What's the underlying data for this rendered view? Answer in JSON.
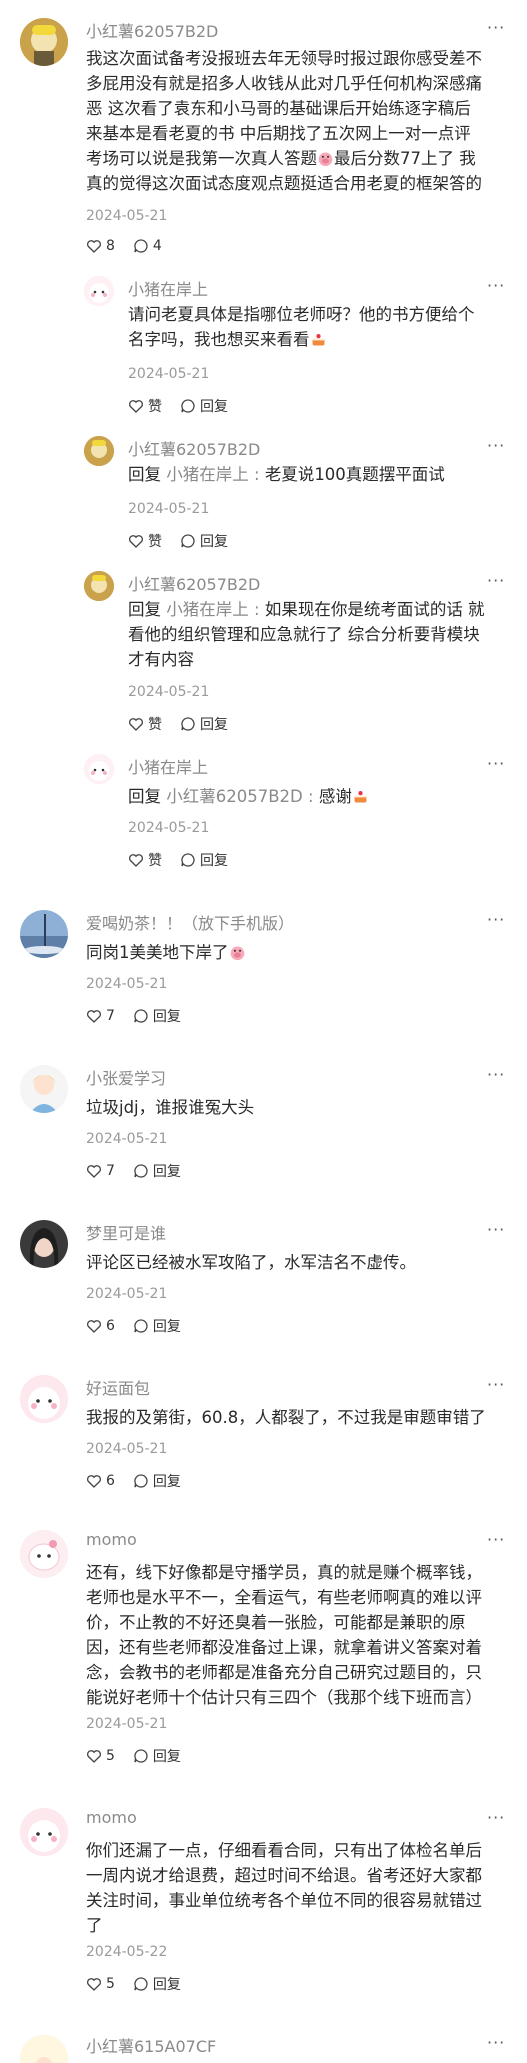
{
  "comments": [
    {
      "name": "小红薯62057B2D",
      "text_lines": [
        "我这次面试备考没报班去年无领导时报过跟你感受差不",
        "多屁用没有就是招多人收钱从此对几乎任何机构深感痛",
        "恶 这次看了袁东和小马哥的基础课后开始练逐字稿后",
        "来基本是看老夏的书 中后期找了五次网上一对一点评",
        "考场可以说是我第一次真人答题",
        "最后分数77上了 我",
        "真的觉得这次面试态度观点题挺适合用老夏的框架答的"
      ],
      "date": "2024-05-21",
      "likes": "8",
      "comments_count": "4",
      "replies": [
        {
          "name": "小猪在岸上",
          "text_lines": [
            "请问老夏具体是指哪位老师呀？他的书方便给个",
            "名字吗，我也想买来看看"
          ],
          "date": "2024-05-21",
          "like_label": "赞",
          "reply_label": "回复"
        },
        {
          "name": "小红薯62057B2D",
          "reply_prefix": "回复",
          "reply_to": "小猪在岸上",
          "colon": " : ",
          "text": "老夏说100真题摆平面试",
          "date": "2024-05-21",
          "like_label": "赞",
          "reply_label": "回复"
        },
        {
          "name": "小红薯62057B2D",
          "reply_prefix": "回复",
          "reply_to": "小猪在岸上",
          "colon": " : ",
          "text_lines": [
            "如果现在你是统考面试的话 就",
            "看他的组织管理和应急就行了 综合分析要背模块",
            "才有内容"
          ],
          "date": "2024-05-21",
          "like_label": "赞",
          "reply_label": "回复"
        },
        {
          "name": "小猪在岸上",
          "reply_prefix": "回复",
          "reply_to": "小红薯62057B2D",
          "colon": " : ",
          "text": "感谢",
          "date": "2024-05-21",
          "like_label": "赞",
          "reply_label": "回复"
        }
      ]
    },
    {
      "name": "爱喝奶茶！！（放下手机版）",
      "text": "同岗1美美地下岸了",
      "date": "2024-05-21",
      "likes": "7",
      "reply_label": "回复"
    },
    {
      "name": "小张爱学习",
      "text": "垃圾jdj，谁报谁冤大头",
      "date": "2024-05-21",
      "likes": "7",
      "reply_label": "回复"
    },
    {
      "name": "梦里可是谁",
      "text": "评论区已经被水军攻陷了，水军洁名不虚传。",
      "date": "2024-05-21",
      "likes": "6",
      "reply_label": "回复"
    },
    {
      "name": "好运面包",
      "text": "我报的及第街，60.8，人都裂了，不过我是审题审错了",
      "date": "2024-05-21",
      "likes": "6",
      "reply_label": "回复"
    },
    {
      "name": "momo",
      "text_lines": [
        "还有，线下好像都是守播学员，真的就是赚个概率钱，",
        "老师也是水平不一，全看运气，有些老师啊真的难以评",
        "价，不止教的不好还臭着一张脸，可能都是兼职的原",
        "因，还有些老师都没准备过上课，就拿着讲义答案对着",
        "念，会教书的老师都是准备充分自己研究过题目的，只",
        "能说好老师十个估计只有三四个（我那个线下班而言）"
      ],
      "date": "2024-05-21",
      "likes": "5",
      "reply_label": "回复"
    },
    {
      "name": "momo",
      "text_lines": [
        "你们还漏了一点，仔细看看合同，只有出了体检名单后",
        "一周内说才给退费，超过时间不给退。省考还好大家都",
        "关注时间，事业单位统考各个单位不同的很容易就错过",
        "了"
      ],
      "date": "2024-05-22",
      "likes": "5",
      "reply_label": "回复"
    },
    {
      "name": "小红薯615A07CF"
    }
  ],
  "more_label": "···",
  "colors": {
    "name": "#8a8a8a",
    "text": "#2a2a2a",
    "date": "#9a9a9a",
    "background": "#ffffff"
  }
}
